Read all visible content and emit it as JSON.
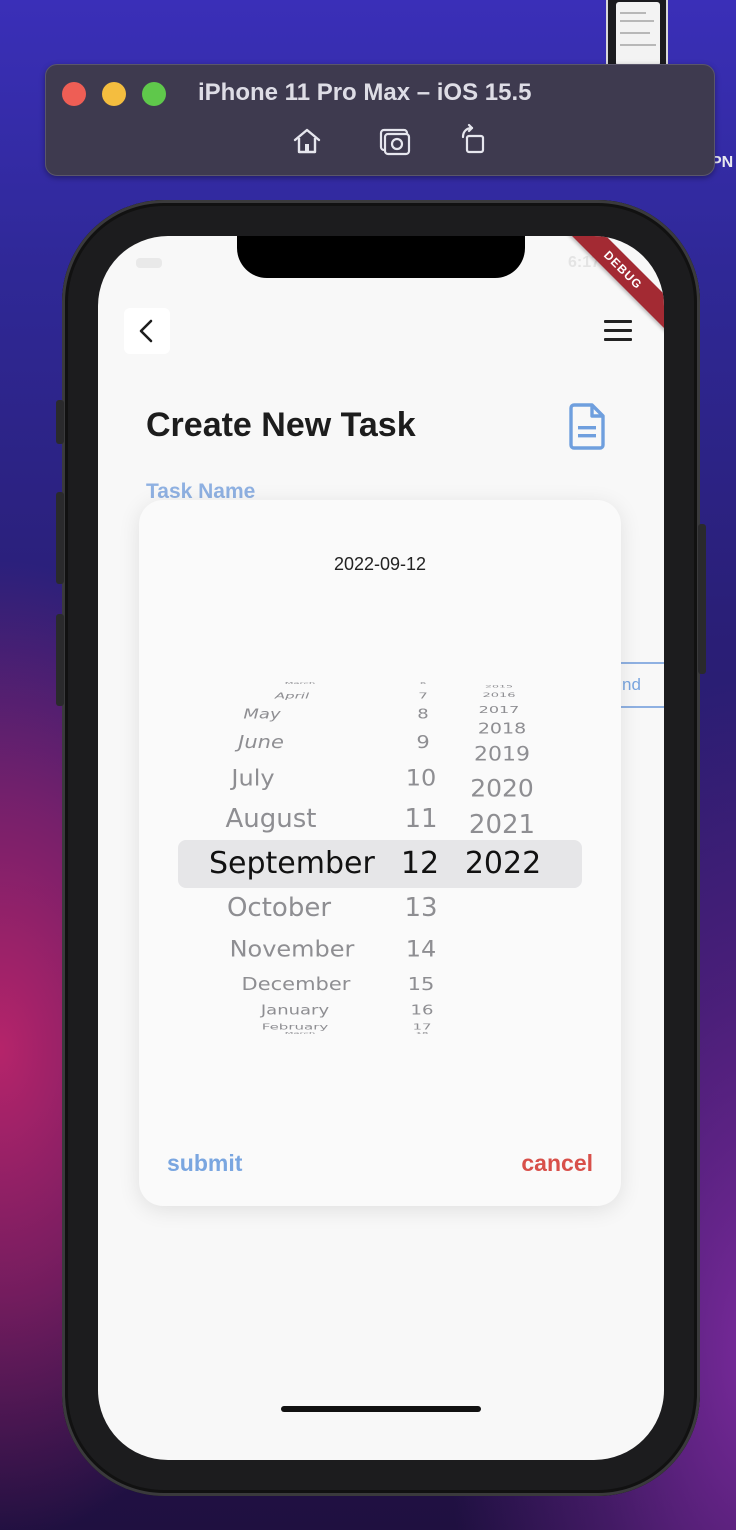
{
  "simulator": {
    "title": "iPhone 11 Pro Max – iOS 15.5",
    "tools": [
      "home-icon",
      "screenshot-icon",
      "rotate-icon"
    ],
    "edge_text": "PN"
  },
  "status": {
    "time": "6:17"
  },
  "debug_banner": "DEBUG",
  "header": {
    "title": "Create New Task",
    "field_label": "Task Name",
    "peek_button": "nd"
  },
  "dialog": {
    "selected_date": "2022-09-12",
    "months": [
      "March",
      "April",
      "May",
      "June",
      "July",
      "August",
      "September",
      "October",
      "November",
      "December",
      "January",
      "February",
      "March"
    ],
    "days": [
      "6",
      "7",
      "8",
      "9",
      "10",
      "11",
      "12",
      "13",
      "14",
      "15",
      "16",
      "17",
      "18"
    ],
    "years": [
      "2015",
      "2016",
      "2017",
      "2018",
      "2019",
      "2020",
      "2021",
      "2022"
    ],
    "selected": {
      "month": "September",
      "day": "12",
      "year": "2022"
    },
    "submit_label": "submit",
    "cancel_label": "cancel"
  },
  "colors": {
    "accent": "#7aa6e0",
    "danger": "#d8504a",
    "debug": "#a32a33"
  }
}
